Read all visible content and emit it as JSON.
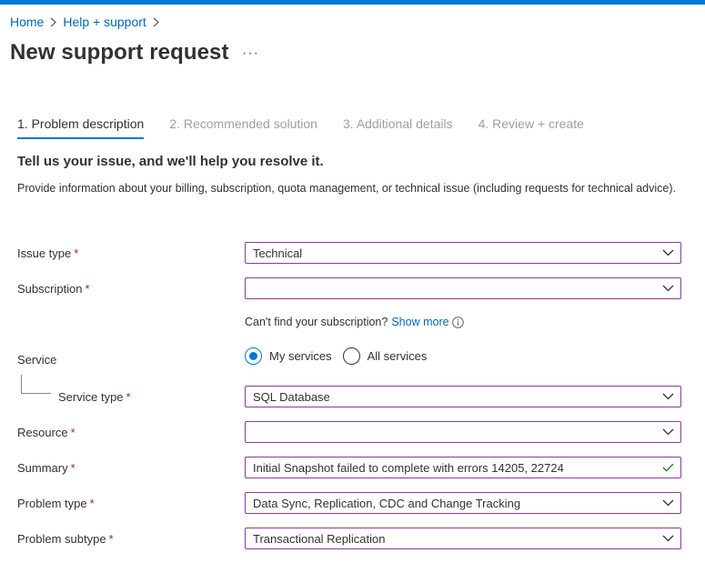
{
  "breadcrumb": {
    "home": "Home",
    "help": "Help + support"
  },
  "page": {
    "title": "New support request",
    "more": "···"
  },
  "tabs": [
    {
      "label": "1. Problem description",
      "active": true
    },
    {
      "label": "2. Recommended solution",
      "active": false
    },
    {
      "label": "3. Additional details",
      "active": false
    },
    {
      "label": "4. Review + create",
      "active": false
    }
  ],
  "section": {
    "title": "Tell us your issue, and we'll help you resolve it.",
    "description": "Provide information about your billing, subscription, quota management, or technical issue (including requests for technical advice)."
  },
  "form": {
    "required_mark": "*",
    "issue_type": {
      "label": "Issue type",
      "value": "Technical"
    },
    "subscription": {
      "label": "Subscription",
      "value": ""
    },
    "subscription_hint": {
      "text": "Can't find your subscription?",
      "link": "Show more"
    },
    "service": {
      "label": "Service",
      "options": [
        {
          "label": "My services",
          "selected": true
        },
        {
          "label": "All services",
          "selected": false
        }
      ]
    },
    "service_type": {
      "label": "Service type",
      "value": "SQL Database"
    },
    "resource": {
      "label": "Resource",
      "value": ""
    },
    "summary": {
      "label": "Summary",
      "value": "Initial Snapshot failed to complete with errors 14205, 22724",
      "valid": true
    },
    "problem_type": {
      "label": "Problem type",
      "value": "Data Sync, Replication, CDC and Change Tracking"
    },
    "problem_subtype": {
      "label": "Problem subtype",
      "value": "Transactional Replication"
    }
  },
  "colors": {
    "accent": "#0078d4",
    "link": "#0067b8",
    "field_border": "#8a3a9a",
    "required": "#a4262c",
    "valid": "#107c10"
  }
}
